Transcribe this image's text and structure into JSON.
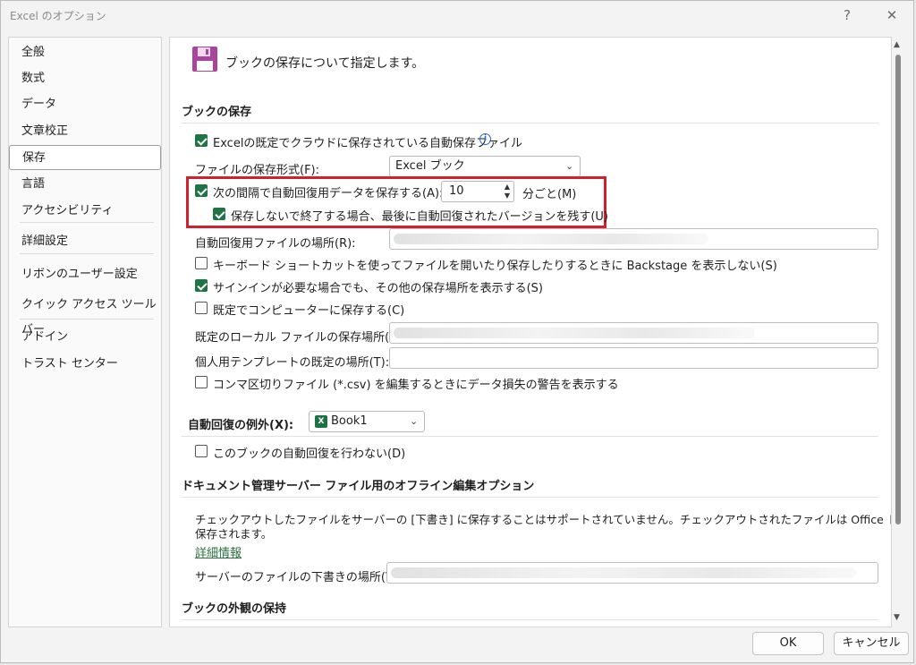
{
  "window": {
    "title": "Excel のオプション",
    "help": "?",
    "close": "✕"
  },
  "sidebar": {
    "items": [
      {
        "label": "全般"
      },
      {
        "label": "数式"
      },
      {
        "label": "データ"
      },
      {
        "label": "文章校正"
      },
      {
        "label": "保存",
        "selected": true
      },
      {
        "label": "言語"
      },
      {
        "label": "アクセシビリティ"
      },
      {
        "label": "詳細設定"
      },
      {
        "label": "リボンのユーザー設定"
      },
      {
        "label": "クイック アクセス ツール バー"
      },
      {
        "label": "アドイン"
      },
      {
        "label": "トラスト センター"
      }
    ]
  },
  "main": {
    "header": "ブックの保存について指定します。",
    "save_section": {
      "title": "ブックの保存",
      "autosave_cloud": {
        "label": "Excelの既定でクラウドに保存されている自動保存ファイル",
        "checked": true
      },
      "format_label": "ファイルの保存形式(F):",
      "format_value": "Excel ブック",
      "autorecover": {
        "label": "次の間隔で自動回復用データを保存する(A):",
        "checked": true
      },
      "interval_value": "10",
      "interval_unit": "分ごと(M)",
      "keep_last": {
        "label": "保存しないで終了する場合、最後に自動回復されたバージョンを残す(U)",
        "checked": true
      },
      "autorecover_location_label": "自動回復用ファイルの場所(R):",
      "backstage": {
        "label": "キーボード ショートカットを使ってファイルを開いたり保存したりするときに Backstage を表示しない(S)",
        "checked": false
      },
      "show_other_locations": {
        "label": "サインインが必要な場合でも、その他の保存場所を表示する(S)",
        "checked": true
      },
      "save_to_computer": {
        "label": "既定でコンピューターに保存する(C)",
        "checked": false
      },
      "local_location_label": "既定のローカル ファイルの保存場所(I):",
      "template_location_label": "個人用テンプレートの既定の場所(T):",
      "csv_warning": {
        "label": "コンマ区切りファイル (*.csv) を編集するときにデータ損失の警告を表示する",
        "checked": false
      }
    },
    "exceptions": {
      "label": "自動回復の例外(X):",
      "workbook": "Book1",
      "disable": {
        "label": "このブックの自動回復を行わない(D)",
        "checked": false
      }
    },
    "offline": {
      "title": "ドキュメント管理サーバー ファイル用のオフライン編集オプション",
      "description_line1": "チェックアウトしたファイルをサーバーの [下書き] に保存することはサポートされていません。チェックアウトされたファイルは Office ドキュメント キャッシュに",
      "description_line2": "保存されます。",
      "link": "詳細情報",
      "drafts_label": "サーバーのファイルの下書きの場所(V):"
    },
    "appearance_title": "ブックの外観の保持"
  },
  "buttons": {
    "ok": "OK",
    "cancel": "キャンセル"
  },
  "colors": {
    "accent_green": "#217346",
    "highlight_red": "#d1202e"
  }
}
